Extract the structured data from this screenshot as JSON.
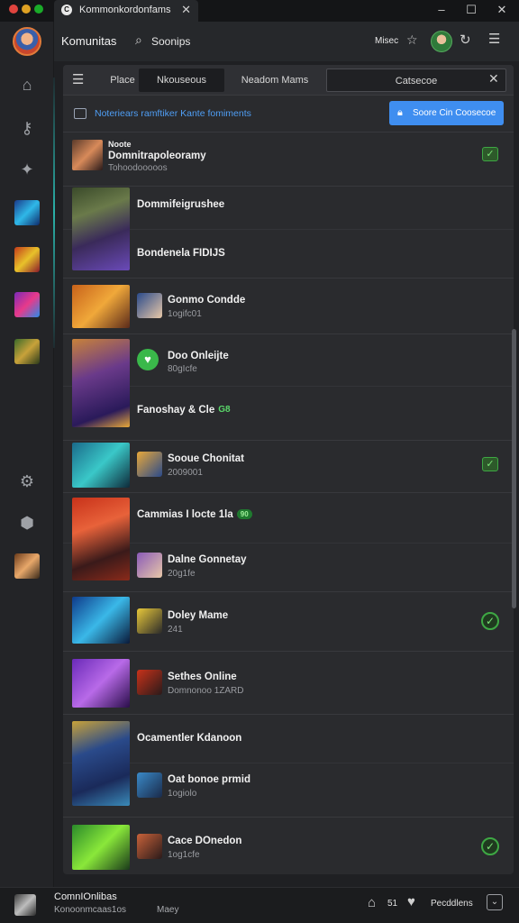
{
  "titlebar": {
    "tab_title": "Kommonkordonfams",
    "tab_icon": "C",
    "colors": {
      "close": "#e0443e",
      "minimize": "#dea123",
      "maximize": "#1aab29"
    }
  },
  "toolbar": {
    "app_name": "Komunitas",
    "search_text": "Soonips",
    "right_label": "Misec"
  },
  "tabs": {
    "items": [
      "Place",
      "Nkouseous",
      "Neadom Mams",
      "Catsecoe"
    ]
  },
  "notification": {
    "text": "Noteriears ramftiker Kante fomiments",
    "button_label": "Soore Cin Coosecoe"
  },
  "rows": [
    {
      "title": "Noote",
      "title2": "Domnitrapoleoramy",
      "sub": "Tohoodooooos",
      "check": "square"
    },
    {
      "title": "Dommifeigrushee",
      "sub": "",
      "check": ""
    },
    {
      "title": "Bondenela FIDIJS",
      "sub": "",
      "check": ""
    },
    {
      "title": "Gonmo Condde",
      "sub": "1ogifc01",
      "check": ""
    },
    {
      "title": "Doo Onleijte",
      "sub": "80gIcfe",
      "check": ""
    },
    {
      "title": "Fanoshay & Cle",
      "badge": "G8",
      "sub": "",
      "check": ""
    },
    {
      "title": "Sooue Chonitat",
      "sub": "2009001",
      "check": "square"
    },
    {
      "title": "Cammias I locte 1la",
      "badge": "90",
      "sub": "",
      "check": ""
    },
    {
      "title": "Dalne Gonnetay",
      "sub": "20g1fe",
      "check": ""
    },
    {
      "title": "Doley Mame",
      "sub": "241",
      "check": "circle"
    },
    {
      "title": "Sethes Online",
      "sub": "Domnonoo 1ZARD",
      "check": ""
    },
    {
      "title": "Ocamentler Kdanoon",
      "sub": "",
      "check": ""
    },
    {
      "title": "Oat bonoe prmid",
      "sub": "1ogiolo",
      "check": ""
    },
    {
      "title": "Cace DOnedon",
      "sub": "1og1cfe",
      "check": "circle"
    }
  ],
  "checkmark": "✓",
  "footer": {
    "title": "ComnIOnlibas",
    "subtitle": "Konoonmcaas1os",
    "extra": "Maey",
    "count": "51",
    "right_label": "Pecddlens"
  }
}
